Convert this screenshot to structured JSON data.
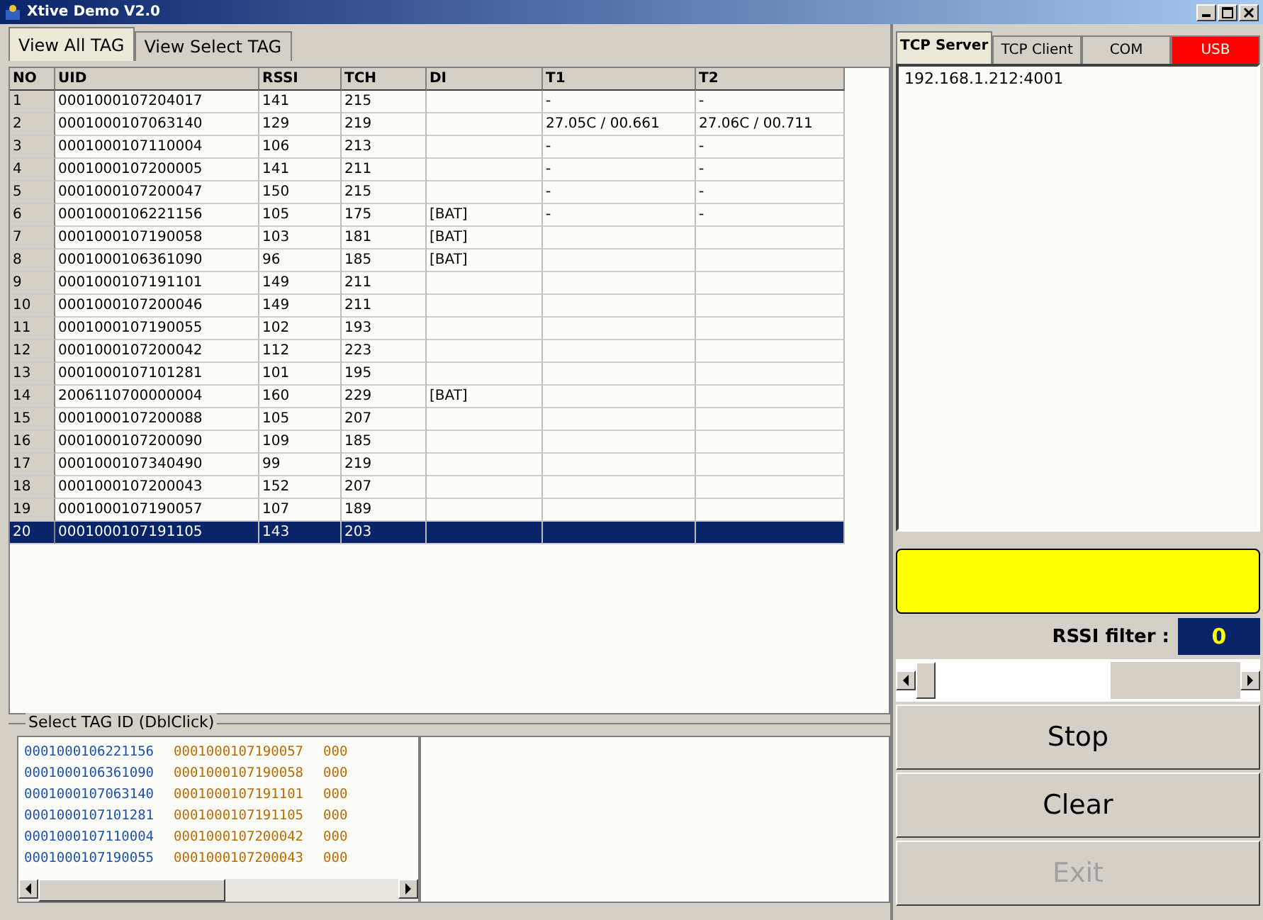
{
  "window": {
    "title": "Xtive Demo V2.0"
  },
  "tabs": [
    {
      "label": "View All TAG",
      "selected": true
    },
    {
      "label": "View Select TAG",
      "selected": false
    }
  ],
  "table": {
    "columns": [
      "NO",
      "UID",
      "RSSI",
      "TCH",
      "DI",
      "T1",
      "T2"
    ],
    "rows": [
      {
        "cells": [
          "1",
          "0001000107204017",
          "141",
          "215",
          "",
          "-",
          "-"
        ],
        "selected": false
      },
      {
        "cells": [
          "2",
          "0001000107063140",
          "129",
          "219",
          "",
          "27.05C / 00.661",
          "27.06C / 00.711"
        ],
        "selected": false
      },
      {
        "cells": [
          "3",
          "0001000107110004",
          "106",
          "213",
          "",
          "-",
          "-"
        ],
        "selected": false
      },
      {
        "cells": [
          "4",
          "0001000107200005",
          "141",
          "211",
          "",
          "-",
          "-"
        ],
        "selected": false
      },
      {
        "cells": [
          "5",
          "0001000107200047",
          "150",
          "215",
          "",
          "-",
          "-"
        ],
        "selected": false
      },
      {
        "cells": [
          "6",
          "0001000106221156",
          "105",
          "175",
          "[BAT]",
          "-",
          "-"
        ],
        "selected": false
      },
      {
        "cells": [
          "7",
          "0001000107190058",
          "103",
          "181",
          "[BAT]",
          "",
          ""
        ],
        "selected": false
      },
      {
        "cells": [
          "8",
          "0001000106361090",
          "96",
          "185",
          "[BAT]",
          "",
          ""
        ],
        "selected": false
      },
      {
        "cells": [
          "9",
          "0001000107191101",
          "149",
          "211",
          "",
          "",
          ""
        ],
        "selected": false
      },
      {
        "cells": [
          "10",
          "0001000107200046",
          "149",
          "211",
          "",
          "",
          ""
        ],
        "selected": false
      },
      {
        "cells": [
          "11",
          "0001000107190055",
          "102",
          "193",
          "",
          "",
          ""
        ],
        "selected": false
      },
      {
        "cells": [
          "12",
          "0001000107200042",
          "112",
          "223",
          "",
          "",
          ""
        ],
        "selected": false
      },
      {
        "cells": [
          "13",
          "0001000107101281",
          "101",
          "195",
          "",
          "",
          ""
        ],
        "selected": false
      },
      {
        "cells": [
          "14",
          "2006110700000004",
          "160",
          "229",
          "[BAT]",
          "",
          ""
        ],
        "selected": false
      },
      {
        "cells": [
          "15",
          "0001000107200088",
          "105",
          "207",
          "",
          "",
          ""
        ],
        "selected": false
      },
      {
        "cells": [
          "16",
          "0001000107200090",
          "109",
          "185",
          "",
          "",
          ""
        ],
        "selected": false
      },
      {
        "cells": [
          "17",
          "0001000107340490",
          "99",
          "219",
          "",
          "",
          ""
        ],
        "selected": false
      },
      {
        "cells": [
          "18",
          "0001000107200043",
          "152",
          "207",
          "",
          "",
          ""
        ],
        "selected": false
      },
      {
        "cells": [
          "19",
          "0001000107190057",
          "107",
          "189",
          "",
          "",
          ""
        ],
        "selected": false
      },
      {
        "cells": [
          "20",
          "0001000107191105",
          "143",
          "203",
          "",
          "",
          ""
        ],
        "selected": true
      }
    ]
  },
  "select_group": {
    "title": "Select TAG ID (DblClick)",
    "columns": [
      {
        "color": "#1a4fb0",
        "items": [
          "0001000106221156",
          "0001000106361090",
          "0001000107063140",
          "0001000107101281",
          "0001000107110004",
          "0001000107190055"
        ]
      },
      {
        "color": "#b86a00",
        "items": [
          "0001000107190057",
          "0001000107190058",
          "0001000107191101",
          "0001000107191105",
          "0001000107200042",
          "0001000107200043"
        ]
      },
      {
        "color": "#b86a00",
        "items": [
          "000",
          "000",
          "000",
          "000",
          "000",
          "000"
        ]
      }
    ]
  },
  "conn_tabs": [
    {
      "label": "TCP Server",
      "selected": true,
      "alert": false
    },
    {
      "label": "TCP Client",
      "selected": false,
      "alert": false
    },
    {
      "label": "COM",
      "selected": false,
      "alert": false
    },
    {
      "label": "USB",
      "selected": false,
      "alert": true
    }
  ],
  "log": [
    "192.168.1.212:4001"
  ],
  "rssi_filter": {
    "label": "RSSI filter :",
    "value": "0",
    "level": 0
  },
  "buttons": [
    {
      "label": "Stop",
      "disabled": false
    },
    {
      "label": "Clear",
      "disabled": false
    },
    {
      "label": "Exit",
      "disabled": true
    }
  ]
}
